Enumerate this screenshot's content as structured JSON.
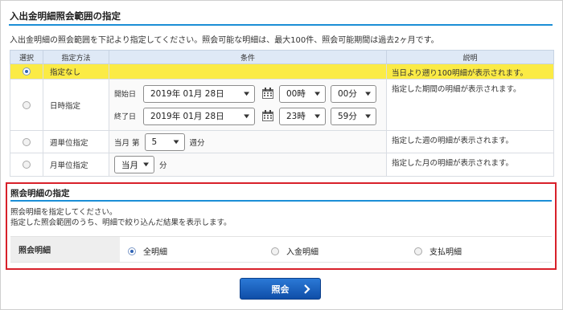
{
  "range_section": {
    "title": "入出金明細照会範囲の指定",
    "lead": "入出金明細の照会範囲を下記より指定してください。照会可能な明細は、最大100件、照会可能期間は過去2ヶ月です。",
    "headers": {
      "select": "選択",
      "method": "指定方法",
      "condition": "条件",
      "description": "説明"
    },
    "rows": {
      "none": {
        "method": "指定なし",
        "description": "当日より遡り100明細が表示されます。",
        "selected": true
      },
      "date": {
        "method": "日時指定",
        "description": "指定した期間の明細が表示されます。",
        "start_label": "開始日",
        "start_date": "2019年 01月 28日",
        "start_hour": "00時",
        "start_minute": "00分",
        "end_label": "終了日",
        "end_date": "2019年 01月 28日",
        "end_hour": "23時",
        "end_minute": "59分"
      },
      "week": {
        "method": "週単位指定",
        "description": "指定した週の明細が表示されます。",
        "prefix": "当月 第",
        "week_value": "5",
        "suffix": "週分"
      },
      "month": {
        "method": "月単位指定",
        "description": "指定した月の明細が表示されます。",
        "month_value": "当月",
        "suffix": "分"
      }
    }
  },
  "detail_section": {
    "title": "照会明細の指定",
    "line1": "照会明細を指定してください。",
    "line2": "指定した照会範囲のうち、明細で絞り込んだ結果を表示します。",
    "row_label": "照会明細",
    "options": [
      {
        "label": "全明細",
        "selected": true
      },
      {
        "label": "入金明細",
        "selected": false
      },
      {
        "label": "支払明細",
        "selected": false
      }
    ]
  },
  "submit": {
    "label": "照会"
  },
  "icons": {
    "calendar": "calendar-icon",
    "chevron": "chevron-down-icon",
    "arrow": "chevron-right-icon"
  },
  "colors": {
    "accent_rule": "#1b8ed6",
    "selected_row": "#fbeb45",
    "table_header": "#dfe9f6",
    "detail_border": "#d8202a",
    "button": "#1a5fbd"
  }
}
